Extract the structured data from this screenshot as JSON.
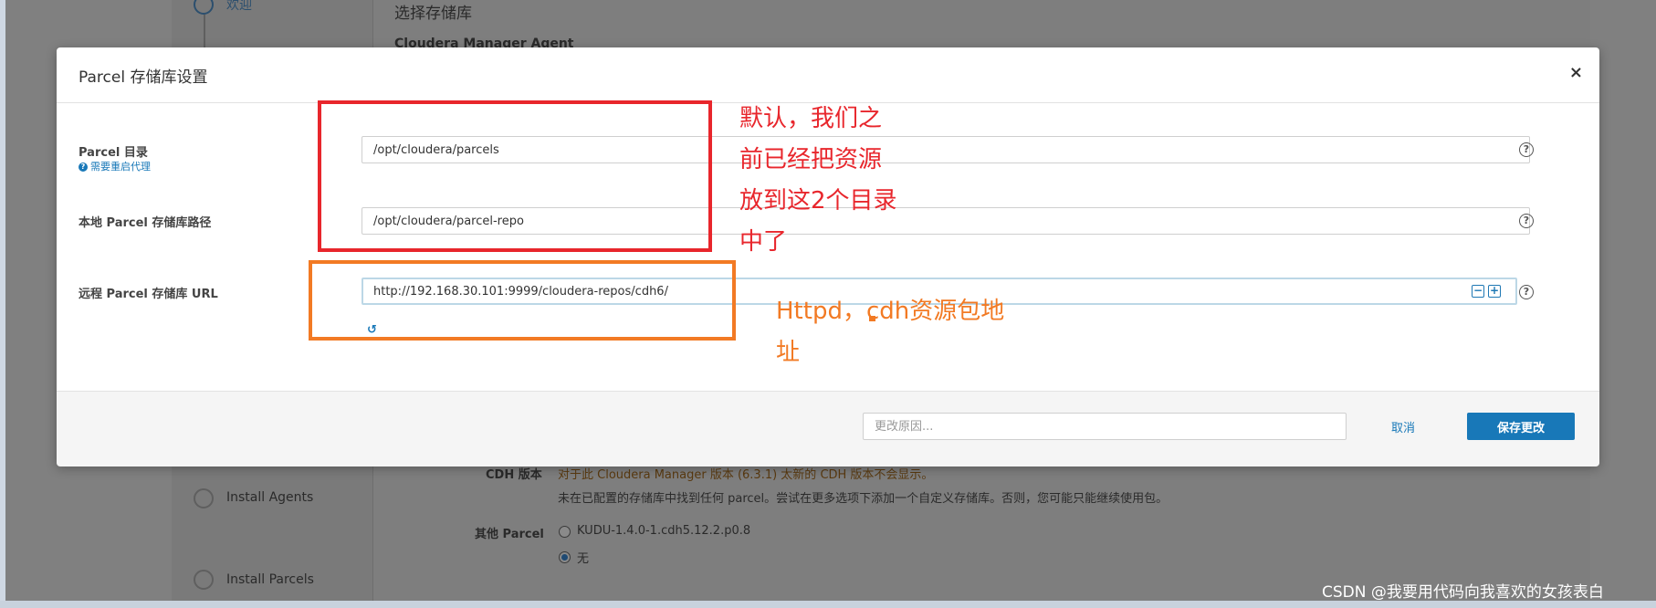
{
  "background": {
    "step_welcome": "欢迎",
    "section_title": "选择存储库",
    "agent_label": "Cloudera Manager Agent",
    "step_install_agents": "Install Agents",
    "step_install_parcels": "Install Parcels",
    "cdh_version_label": "CDH 版本",
    "cdh_warning": "对于此 Cloudera Manager 版本 (6.3.1) 太新的 CDH 版本不会显示。",
    "cdh_info": "未在已配置的存储库中找到任何 parcel。尝试在更多选项下添加一个自定义存储库。否则，您可能只能继续使用包。",
    "other_parcel_label": "其他 Parcel",
    "other_parcel_options": [
      "KUDU-1.4.0-1.cdh5.12.2.p0.8",
      "无"
    ],
    "other_parcel_selected": "无"
  },
  "modal": {
    "title": "Parcel 存储库设置",
    "close_symbol": "×",
    "fields": [
      {
        "label": "Parcel 目录",
        "hint": "需要重启代理",
        "value": "/opt/cloudera/parcels"
      },
      {
        "label": "本地 Parcel 存储库路径",
        "value": "/opt/cloudera/parcel-repo"
      },
      {
        "label": "远程 Parcel 存储库 URL",
        "value": "http://192.168.30.101:9999/cloudera-repos/cdh6/"
      }
    ],
    "help_symbol": "?",
    "remove_symbol": "−",
    "add_symbol": "+",
    "undo_symbol": "↺",
    "footer": {
      "reason_placeholder": "更改原因...",
      "cancel_label": "取消",
      "save_label": "保存更改"
    }
  },
  "annotations": {
    "red_lines": [
      "默认，我们之",
      "前已经把资源",
      "放到这2个目录",
      "中了"
    ],
    "orange_lines": [
      "Httpd，cdh资源包地",
      "址"
    ],
    "colors": {
      "red": "#e8262c",
      "orange": "#f27a24"
    }
  },
  "watermark": "CSDN @我要用代码向我喜欢的女孩表白"
}
